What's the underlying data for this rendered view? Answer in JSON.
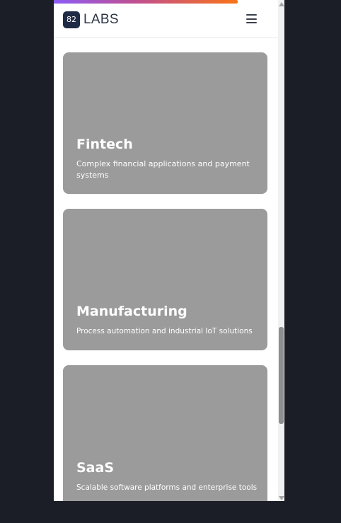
{
  "progress": {
    "fraction": 0.82,
    "colors": [
      "#8b5cf6",
      "#c04f8f",
      "#f97316"
    ]
  },
  "header": {
    "logo_badge": "82",
    "logo_text": "LABS",
    "menu_icon": "hamburger-icon"
  },
  "cards": [
    {
      "title": "Fintech",
      "description": "Complex financial applications and payment systems"
    },
    {
      "title": "Manufacturing",
      "description": "Process automation and industrial IoT solutions"
    },
    {
      "title": "SaaS",
      "description": "Scalable software platforms and enterprise tools"
    }
  ],
  "scrollbar": {
    "position_fraction": 0.75
  },
  "colors": {
    "page_background": "#1b1e27",
    "card_background": "#9b9b9b",
    "logo_badge": "#1f2a44"
  }
}
